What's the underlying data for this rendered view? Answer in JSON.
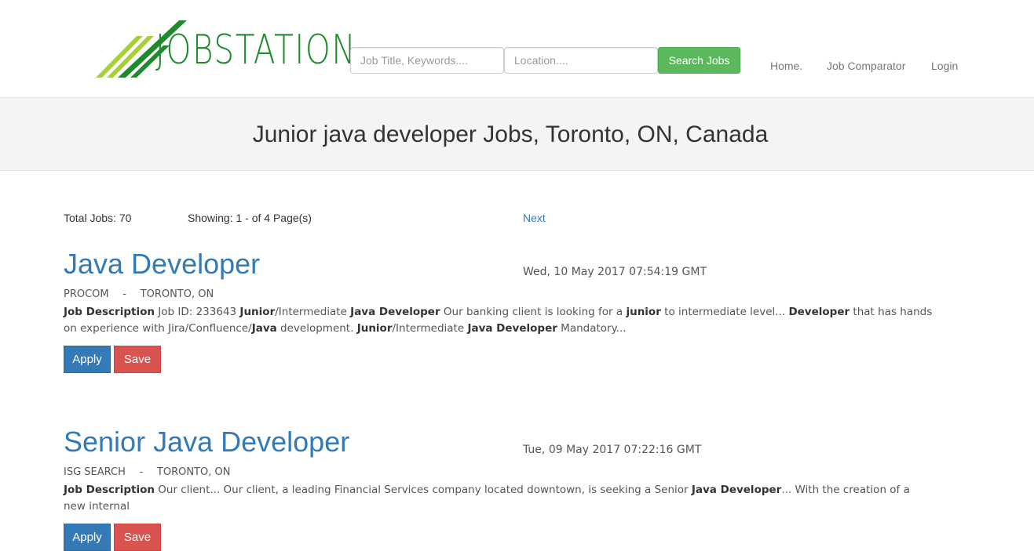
{
  "brand": {
    "logo_text": "JOBSTATION",
    "primary_green": "#1f8a2c",
    "light_green": "#a8cf38"
  },
  "search": {
    "keywords_placeholder": "Job Title, Keywords....",
    "location_placeholder": "Location....",
    "button_label": "Search Jobs"
  },
  "nav": {
    "home": "Home.",
    "comparator": "Job Comparator",
    "login": "Login"
  },
  "banner": {
    "heading": "Junior java developer Jobs, Toronto, ON, Canada"
  },
  "results": {
    "total_jobs": "Total Jobs: 70",
    "showing": "Showing: 1 - of 4 Page(s)",
    "next": "Next"
  },
  "jobs": [
    {
      "title": "Java Developer",
      "date": "Wed, 10 May 2017 07:54:19 GMT",
      "company": "PROCOM",
      "separator": "-",
      "location": "TORONTO, ON",
      "description_parts": [
        {
          "t": "Job Description",
          "b": true
        },
        {
          "t": " Job ID: 233643 ",
          "b": false
        },
        {
          "t": "Junior",
          "b": true
        },
        {
          "t": "/Intermediate ",
          "b": false
        },
        {
          "t": "Java Developer",
          "b": true
        },
        {
          "t": " Our banking client is looking for a ",
          "b": false
        },
        {
          "t": "junior",
          "b": true
        },
        {
          "t": " to intermediate level... ",
          "b": false
        },
        {
          "t": "Developer",
          "b": true
        },
        {
          "t": " that has hands on experience with Jira/Confluence/",
          "b": false
        },
        {
          "t": "Java",
          "b": true
        },
        {
          "t": " development. ",
          "b": false
        },
        {
          "t": "Junior",
          "b": true
        },
        {
          "t": "/Intermediate ",
          "b": false
        },
        {
          "t": "Java Developer",
          "b": true
        },
        {
          "t": " Mandatory...",
          "b": false
        }
      ],
      "apply_label": "Apply",
      "save_label": "Save"
    },
    {
      "title": "Senior Java Developer",
      "date": "Tue, 09 May 2017 07:22:16 GMT",
      "company": "ISG SEARCH",
      "separator": "-",
      "location": "TORONTO, ON",
      "description_parts": [
        {
          "t": "Job Description",
          "b": true
        },
        {
          "t": " Our client... Our client, a leading Financial Services company located downtown, is seeking a Senior ",
          "b": false
        },
        {
          "t": "Java Developer",
          "b": true
        },
        {
          "t": "... With the creation of a new internal",
          "b": false
        }
      ],
      "apply_label": "Apply",
      "save_label": "Save"
    }
  ]
}
